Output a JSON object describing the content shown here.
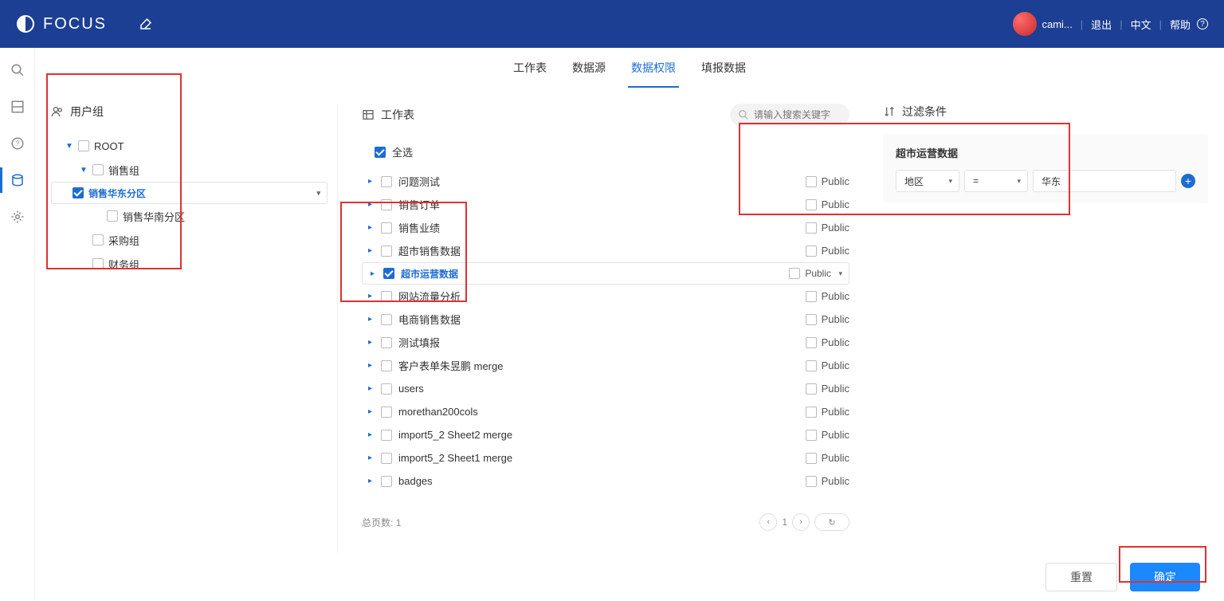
{
  "brand": "FOCUS",
  "header": {
    "user": "cami...",
    "logout": "退出",
    "lang": "中文",
    "help": "帮助"
  },
  "tabs": {
    "worksheets": "工作表",
    "datasource": "数据源",
    "datapermission": "数据权限",
    "fillreport": "填报数据"
  },
  "panels": {
    "usergroup": "用户组",
    "worksheet": "工作表",
    "filter": "过滤条件"
  },
  "tree": [
    {
      "label": "ROOT",
      "indent": 1,
      "caret": "▼",
      "checked": false,
      "sel": false
    },
    {
      "label": "销售组",
      "indent": 2,
      "caret": "▼",
      "checked": false,
      "sel": false
    },
    {
      "label": "销售华东分区",
      "indent": 3,
      "caret": "",
      "checked": true,
      "sel": true
    },
    {
      "label": "销售华南分区",
      "indent": 3,
      "caret": "",
      "checked": false,
      "sel": false
    },
    {
      "label": "采购组",
      "indent": 2,
      "caret": "",
      "checked": false,
      "sel": false
    },
    {
      "label": "财务组",
      "indent": 2,
      "caret": "",
      "checked": false,
      "sel": false
    }
  ],
  "selectall": "全选",
  "search": {
    "placeholder": "请输入搜索关键字"
  },
  "public_label": "Public",
  "worksheets": [
    {
      "label": "问题测试",
      "checked": false,
      "sel": false
    },
    {
      "label": "销售订单",
      "checked": false,
      "sel": false
    },
    {
      "label": "销售业绩",
      "checked": false,
      "sel": false
    },
    {
      "label": "超市销售数据",
      "checked": false,
      "sel": false
    },
    {
      "label": "超市运营数据",
      "checked": true,
      "sel": true
    },
    {
      "label": "网站流量分析",
      "checked": false,
      "sel": false
    },
    {
      "label": "电商销售数据",
      "checked": false,
      "sel": false
    },
    {
      "label": "测试填报",
      "checked": false,
      "sel": false
    },
    {
      "label": "客户表单朱昱鹏 merge",
      "checked": false,
      "sel": false
    },
    {
      "label": "users",
      "checked": false,
      "sel": false
    },
    {
      "label": "morethan200cols",
      "checked": false,
      "sel": false
    },
    {
      "label": "import5_2 Sheet2 merge",
      "checked": false,
      "sel": false
    },
    {
      "label": "import5_2 Sheet1 merge",
      "checked": false,
      "sel": false
    },
    {
      "label": "badges",
      "checked": false,
      "sel": false
    }
  ],
  "ws_footer": {
    "total_label": "总页数:",
    "total": "1",
    "page": "1"
  },
  "filter": {
    "title": "超市运营数据",
    "field": "地区",
    "op": "=",
    "value": "华东"
  },
  "buttons": {
    "reset": "重置",
    "confirm": "确定"
  }
}
